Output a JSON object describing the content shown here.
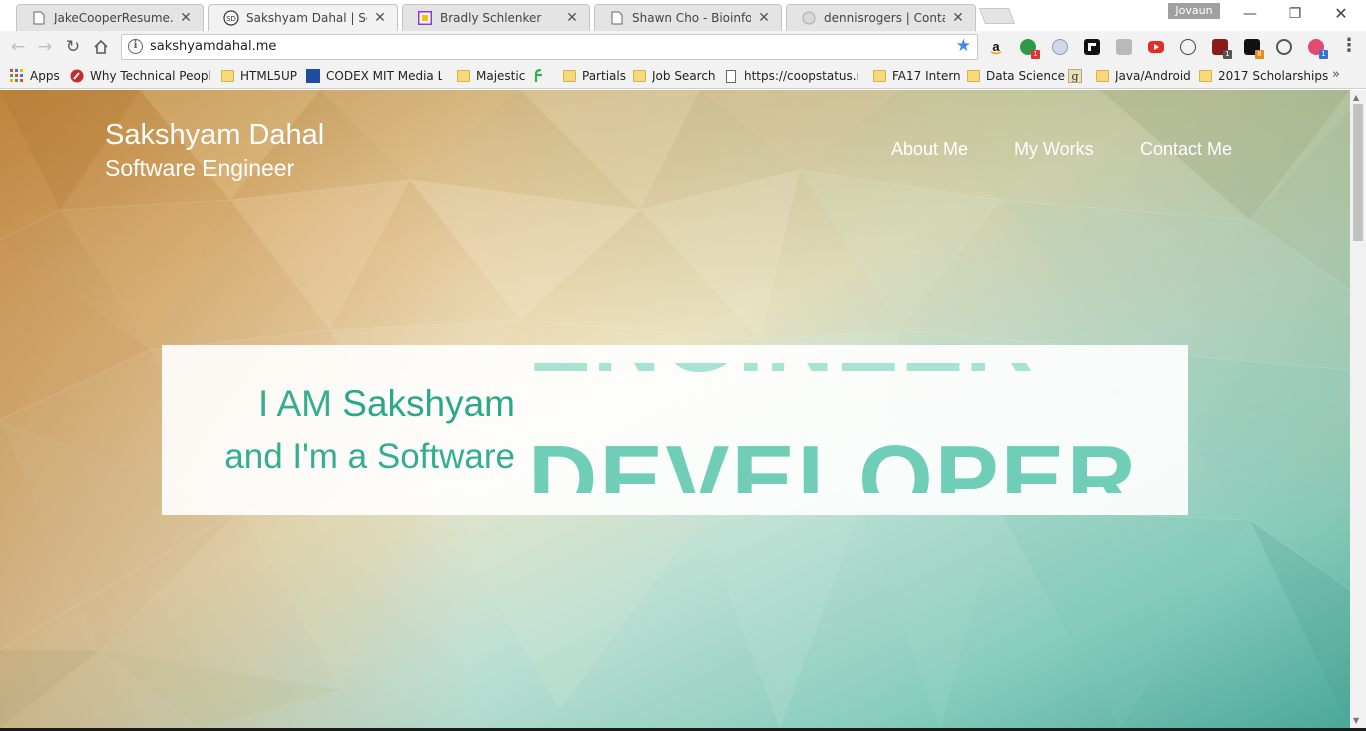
{
  "browser": {
    "profile_name": "Jovaun",
    "tabs": [
      {
        "title": "JakeCooperResume.pdf",
        "icon": "page-icon",
        "active": false
      },
      {
        "title": "Sakshyam Dahal | Software Engineer",
        "icon": "sd-logo-icon",
        "active": true
      },
      {
        "title": "Bradly Schlenker",
        "icon": "bs-logo-icon",
        "active": false
      },
      {
        "title": "Shawn Cho - Bioinformatics",
        "icon": "page-icon",
        "active": false
      },
      {
        "title": "dennisrogers | Contact",
        "icon": "globe-icon",
        "active": false
      }
    ],
    "address": "sakshyamdahal.me",
    "extension_badges": [
      "1",
      "1",
      "8",
      "1"
    ],
    "bookmarks": [
      {
        "label": "Apps",
        "icon": "apps-grid-icon"
      },
      {
        "label": "Why Technical People",
        "icon": "red-circle-icon"
      },
      {
        "label": "HTML5UP",
        "icon": "folder-icon"
      },
      {
        "label": "CODEX MIT Media Lab",
        "icon": "codex-icon"
      },
      {
        "label": "Majestic",
        "icon": "folder-icon"
      },
      {
        "label": "",
        "icon": "feedly-icon"
      },
      {
        "label": "Partials",
        "icon": "folder-icon"
      },
      {
        "label": "Job Search",
        "icon": "folder-icon"
      },
      {
        "label": "https://coopstatus.net",
        "icon": "page-icon"
      },
      {
        "label": "FA17 Intern",
        "icon": "folder-icon"
      },
      {
        "label": "Data Science",
        "icon": "folder-icon"
      },
      {
        "label": "",
        "icon": "g-icon"
      },
      {
        "label": "Java/Android",
        "icon": "folder-icon"
      },
      {
        "label": "2017 Scholarships",
        "icon": "folder-icon"
      }
    ],
    "more_bookmarks": "»"
  },
  "site": {
    "name": "Sakshyam Dahal",
    "tagline": "Software Engineer",
    "nav": [
      "About Me",
      "My Works",
      "Contact Me"
    ],
    "intro": {
      "prefix": "I AM ",
      "name": "Sakshyam",
      "line2": "and I'm a Software",
      "word_above": "ENGINEER",
      "word_current": "DEVELOPER"
    }
  },
  "colors": {
    "accent": "#2aa888",
    "accent_light": "#6fcdb8",
    "accent_faded": "#a7e3d3"
  }
}
